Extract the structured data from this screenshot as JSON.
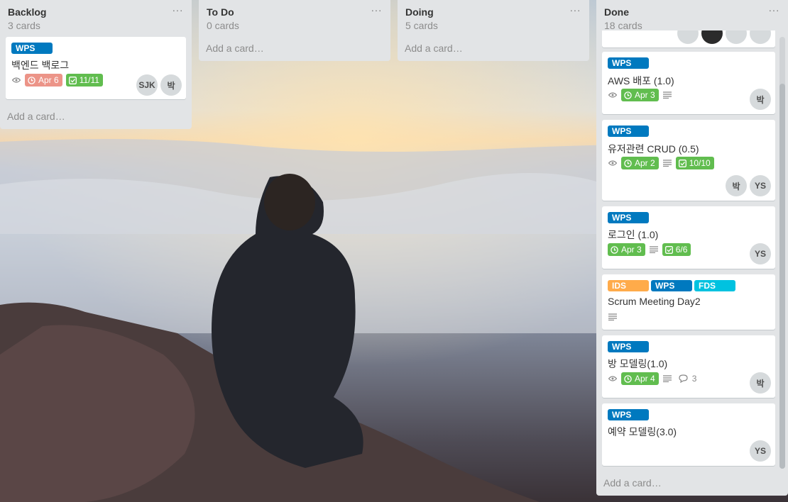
{
  "lists": {
    "backlog": {
      "title": "Backlog",
      "count": "3 cards",
      "add": "Add a card…",
      "cards": [
        {
          "labels": [
            "WPS"
          ],
          "title": "백엔드 백로그",
          "due": "Apr 6",
          "checklist": "11/11",
          "members": [
            "SJK",
            "박"
          ]
        }
      ]
    },
    "todo": {
      "title": "To Do",
      "count": "0 cards",
      "add": "Add a card…"
    },
    "doing": {
      "title": "Doing",
      "count": "5 cards",
      "add": "Add a card…"
    },
    "done": {
      "title": "Done",
      "count": "18 cards",
      "add": "Add a card…",
      "cards": [
        {
          "labels": [
            "WPS"
          ],
          "title": "AWS 배포 (1.0)",
          "due": "Apr 3",
          "members": [
            "박"
          ]
        },
        {
          "labels": [
            "WPS"
          ],
          "title": "유저관련 CRUD (0.5)",
          "due": "Apr 2",
          "checklist": "10/10",
          "members": [
            "박",
            "YS"
          ]
        },
        {
          "labels": [
            "WPS"
          ],
          "title": "로그인 (1.0)",
          "due": "Apr 3",
          "checklist": "6/6",
          "members": [
            "YS"
          ]
        },
        {
          "labels": [
            "IDS",
            "WPS",
            "FDS"
          ],
          "title": "Scrum Meeting Day2"
        },
        {
          "labels": [
            "WPS"
          ],
          "title": "방 모델링(1.0)",
          "due": "Apr 4",
          "comments": "3",
          "members": [
            "박"
          ]
        },
        {
          "labels": [
            "WPS"
          ],
          "title": "예약 모델링(3.0)",
          "members": [
            "YS"
          ]
        }
      ]
    }
  },
  "menu_icon": "···",
  "colors": {
    "label_blue": "#0079bf",
    "label_orange": "#ffab4a",
    "label_cyan": "#00c2e0",
    "due_green": "#61bd4f",
    "due_overdue": "#ec9488"
  }
}
